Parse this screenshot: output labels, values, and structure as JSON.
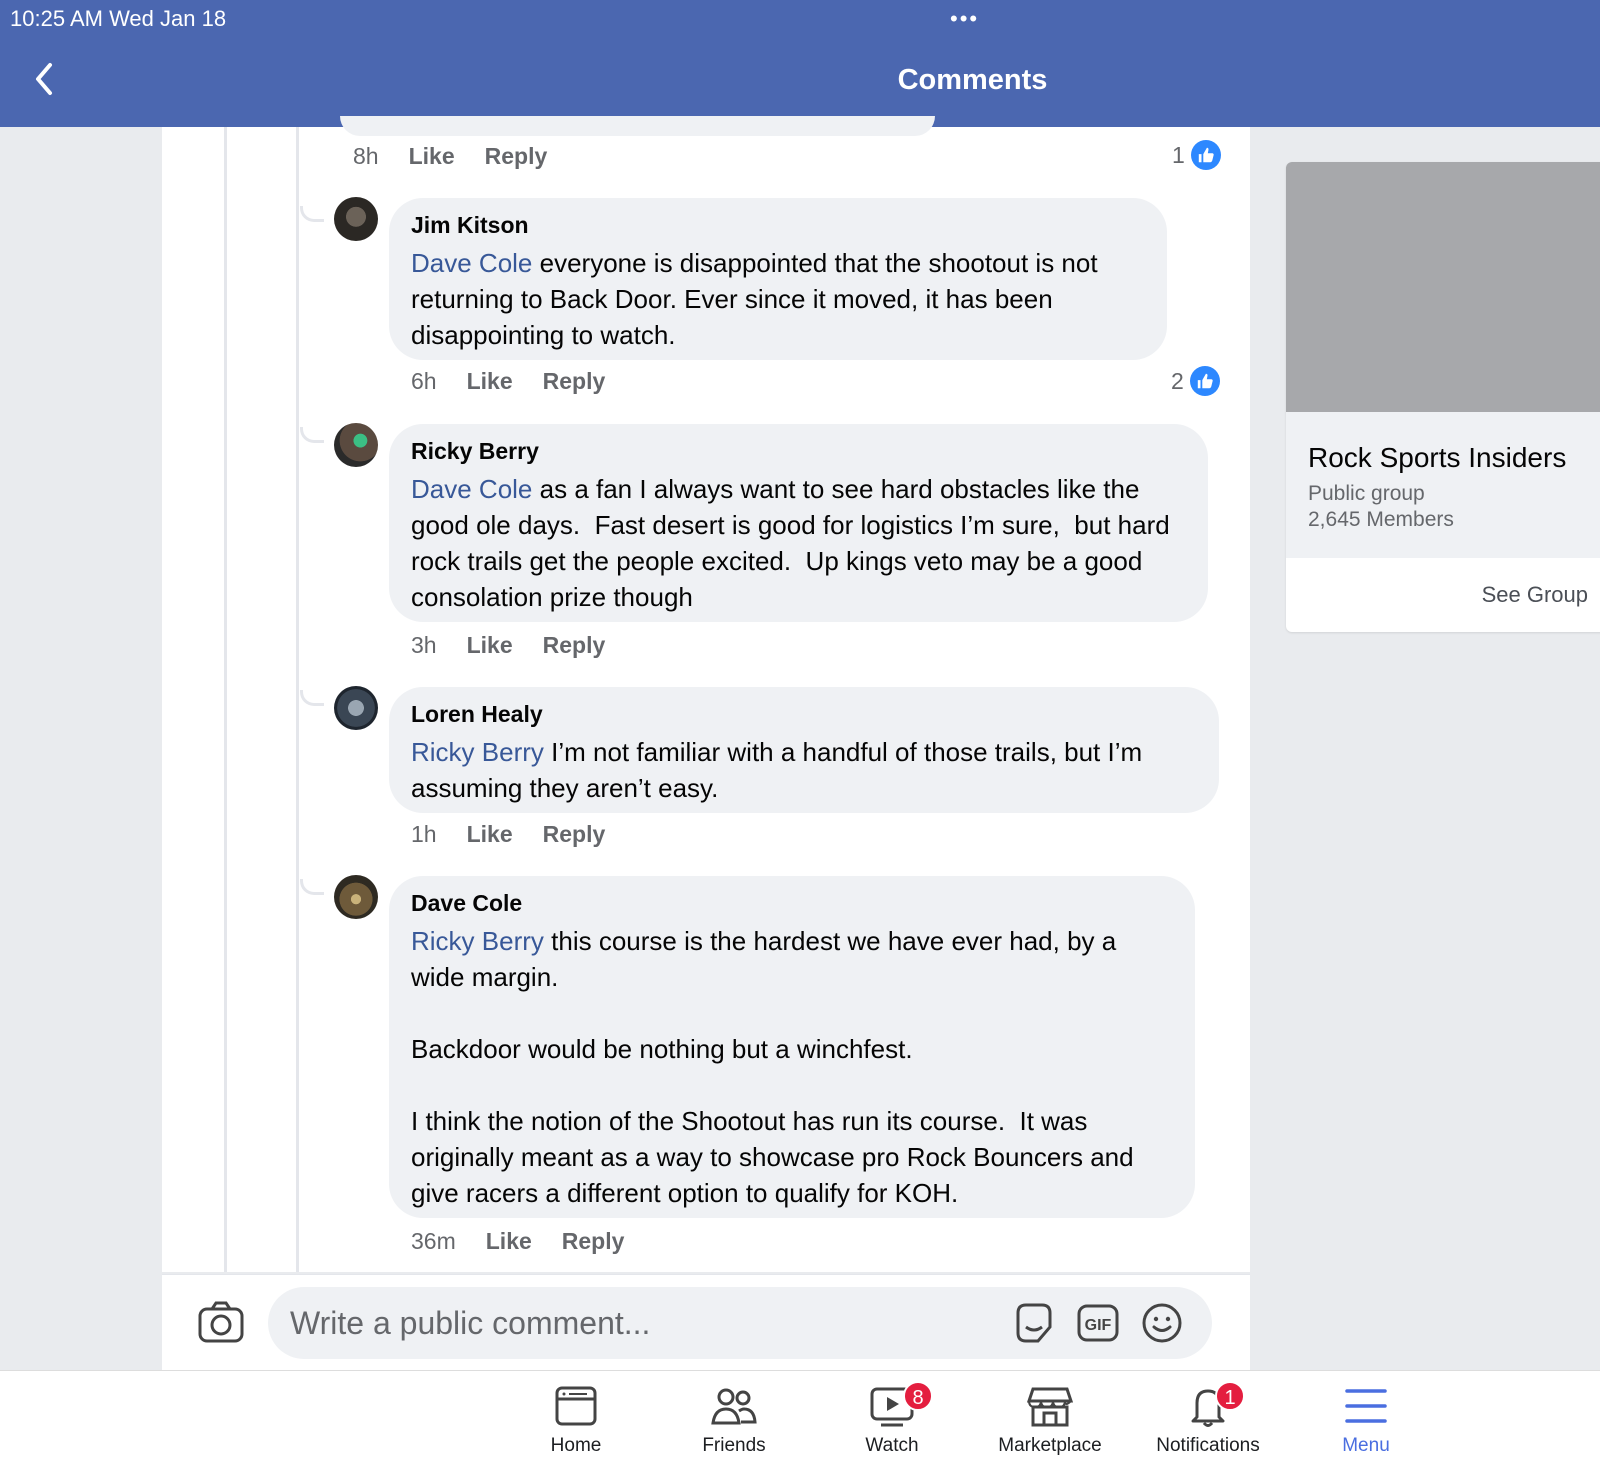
{
  "status_bar": {
    "time": "10:25 AM   Wed Jan 18",
    "dots": "•••"
  },
  "header": {
    "title": "Comments"
  },
  "top_comment_meta": {
    "time": "8h",
    "like": "Like",
    "reply": "Reply",
    "reactions": "1"
  },
  "comments": [
    {
      "author": "Jim Kitson",
      "mention": "Dave Cole",
      "text": " everyone is disappointed that the shootout is not returning to Back Door. Ever since it moved, it has been disappointing to watch.",
      "time": "6h",
      "like": "Like",
      "reply": "Reply",
      "reactions": "2"
    },
    {
      "author": "Ricky Berry",
      "mention": "Dave Cole",
      "text": " as a fan I always want to see hard obstacles like the good ole days.  Fast desert is good for logistics I’m sure,  but hard rock trails get the people excited.  Up kings veto may be a good consolation prize though",
      "time": "3h",
      "like": "Like",
      "reply": "Reply"
    },
    {
      "author": "Loren Healy",
      "mention": "Ricky Berry",
      "text": " I’m not familiar with a handful of those trails, but I’m assuming they aren’t easy.",
      "time": "1h",
      "like": "Like",
      "reply": "Reply"
    },
    {
      "author": "Dave Cole",
      "mention": "Ricky Berry",
      "text": " this course is the hardest we have ever had, by a wide margin.\n\nBackdoor would be nothing but a winchfest.\n\nI think the notion of the Shootout has run its course.  It was originally meant as a way to showcase pro Rock Bouncers and give racers a different option to qualify for KOH.",
      "time": "36m",
      "like": "Like",
      "reply": "Reply"
    }
  ],
  "composer": {
    "placeholder": "Write a public comment...",
    "gif_label": "GIF"
  },
  "group": {
    "name": "Rock Sports Insiders",
    "type": "Public group",
    "members": "2,645 Members",
    "cta": "See Group"
  },
  "tabs": [
    {
      "label": "Home"
    },
    {
      "label": "Friends"
    },
    {
      "label": "Watch",
      "badge": "8"
    },
    {
      "label": "Marketplace"
    },
    {
      "label": "Notifications",
      "badge": "1"
    },
    {
      "label": "Menu"
    }
  ],
  "colors": {
    "brand": "#4b67b0",
    "mention": "#385898",
    "badge": "#e41e3f",
    "active_tab": "#4a6ee0"
  }
}
